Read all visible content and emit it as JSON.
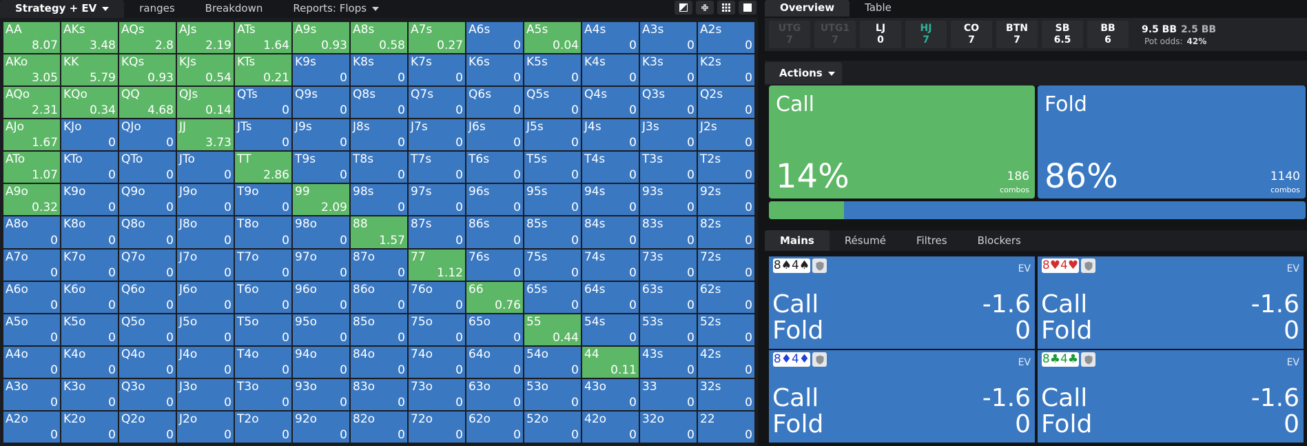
{
  "colors": {
    "green": "#5cb766",
    "blue": "#3a78c2",
    "teal": "#2fb39a"
  },
  "left_tabs": {
    "strategy": "Strategy + EV",
    "ranges": "ranges",
    "breakdown": "Breakdown",
    "reports": "Reports: Flops"
  },
  "toolbar_icons": [
    "contrast-icon",
    "collapse-icon",
    "grid-icon",
    "square-icon"
  ],
  "grid": {
    "rows": [
      [
        [
          "AA",
          "8.07",
          "g"
        ],
        [
          "AKs",
          "3.48",
          "g"
        ],
        [
          "AQs",
          "2.8",
          "g"
        ],
        [
          "AJs",
          "2.19",
          "g"
        ],
        [
          "ATs",
          "1.64",
          "g"
        ],
        [
          "A9s",
          "0.93",
          "g"
        ],
        [
          "A8s",
          "0.58",
          "g"
        ],
        [
          "A7s",
          "0.27",
          "g"
        ],
        [
          "A6s",
          "0",
          "b"
        ],
        [
          "A5s",
          "0.04",
          "g"
        ],
        [
          "A4s",
          "0",
          "b"
        ],
        [
          "A3s",
          "0",
          "b"
        ],
        [
          "A2s",
          "0",
          "b"
        ]
      ],
      [
        [
          "AKo",
          "3.05",
          "g"
        ],
        [
          "KK",
          "5.79",
          "g"
        ],
        [
          "KQs",
          "0.93",
          "g"
        ],
        [
          "KJs",
          "0.54",
          "g"
        ],
        [
          "KTs",
          "0.21",
          "g"
        ],
        [
          "K9s",
          "0",
          "b"
        ],
        [
          "K8s",
          "0",
          "b"
        ],
        [
          "K7s",
          "0",
          "b"
        ],
        [
          "K6s",
          "0",
          "b"
        ],
        [
          "K5s",
          "0",
          "b"
        ],
        [
          "K4s",
          "0",
          "b"
        ],
        [
          "K3s",
          "0",
          "b"
        ],
        [
          "K2s",
          "0",
          "b"
        ]
      ],
      [
        [
          "AQo",
          "2.31",
          "g"
        ],
        [
          "KQo",
          "0.34",
          "g"
        ],
        [
          "QQ",
          "4.68",
          "g"
        ],
        [
          "QJs",
          "0.14",
          "g"
        ],
        [
          "QTs",
          "0",
          "b"
        ],
        [
          "Q9s",
          "0",
          "b"
        ],
        [
          "Q8s",
          "0",
          "b"
        ],
        [
          "Q7s",
          "0",
          "b"
        ],
        [
          "Q6s",
          "0",
          "b"
        ],
        [
          "Q5s",
          "0",
          "b"
        ],
        [
          "Q4s",
          "0",
          "b"
        ],
        [
          "Q3s",
          "0",
          "b"
        ],
        [
          "Q2s",
          "0",
          "b"
        ]
      ],
      [
        [
          "AJo",
          "1.67",
          "g"
        ],
        [
          "KJo",
          "0",
          "b"
        ],
        [
          "QJo",
          "0",
          "b"
        ],
        [
          "JJ",
          "3.73",
          "g"
        ],
        [
          "JTs",
          "0",
          "b"
        ],
        [
          "J9s",
          "0",
          "b"
        ],
        [
          "J8s",
          "0",
          "b"
        ],
        [
          "J7s",
          "0",
          "b"
        ],
        [
          "J6s",
          "0",
          "b"
        ],
        [
          "J5s",
          "0",
          "b"
        ],
        [
          "J4s",
          "0",
          "b"
        ],
        [
          "J3s",
          "0",
          "b"
        ],
        [
          "J2s",
          "0",
          "b"
        ]
      ],
      [
        [
          "ATo",
          "1.07",
          "g"
        ],
        [
          "KTo",
          "0",
          "b"
        ],
        [
          "QTo",
          "0",
          "b"
        ],
        [
          "JTo",
          "0",
          "b"
        ],
        [
          "TT",
          "2.86",
          "g"
        ],
        [
          "T9s",
          "0",
          "b"
        ],
        [
          "T8s",
          "0",
          "b"
        ],
        [
          "T7s",
          "0",
          "b"
        ],
        [
          "T6s",
          "0",
          "b"
        ],
        [
          "T5s",
          "0",
          "b"
        ],
        [
          "T4s",
          "0",
          "b"
        ],
        [
          "T3s",
          "0",
          "b"
        ],
        [
          "T2s",
          "0",
          "b"
        ]
      ],
      [
        [
          "A9o",
          "0.32",
          "g"
        ],
        [
          "K9o",
          "0",
          "b"
        ],
        [
          "Q9o",
          "0",
          "b"
        ],
        [
          "J9o",
          "0",
          "b"
        ],
        [
          "T9o",
          "0",
          "b"
        ],
        [
          "99",
          "2.09",
          "g"
        ],
        [
          "98s",
          "0",
          "b"
        ],
        [
          "97s",
          "0",
          "b"
        ],
        [
          "96s",
          "0",
          "b"
        ],
        [
          "95s",
          "0",
          "b"
        ],
        [
          "94s",
          "0",
          "b"
        ],
        [
          "93s",
          "0",
          "b"
        ],
        [
          "92s",
          "0",
          "b"
        ]
      ],
      [
        [
          "A8o",
          "0",
          "b"
        ],
        [
          "K8o",
          "0",
          "b"
        ],
        [
          "Q8o",
          "0",
          "b"
        ],
        [
          "J8o",
          "0",
          "b"
        ],
        [
          "T8o",
          "0",
          "b"
        ],
        [
          "98o",
          "0",
          "b"
        ],
        [
          "88",
          "1.57",
          "g"
        ],
        [
          "87s",
          "0",
          "b"
        ],
        [
          "86s",
          "0",
          "b"
        ],
        [
          "85s",
          "0",
          "b"
        ],
        [
          "84s",
          "0",
          "b"
        ],
        [
          "83s",
          "0",
          "b"
        ],
        [
          "82s",
          "0",
          "b"
        ]
      ],
      [
        [
          "A7o",
          "0",
          "b"
        ],
        [
          "K7o",
          "0",
          "b"
        ],
        [
          "Q7o",
          "0",
          "b"
        ],
        [
          "J7o",
          "0",
          "b"
        ],
        [
          "T7o",
          "0",
          "b"
        ],
        [
          "97o",
          "0",
          "b"
        ],
        [
          "87o",
          "0",
          "b"
        ],
        [
          "77",
          "1.12",
          "g"
        ],
        [
          "76s",
          "0",
          "b"
        ],
        [
          "75s",
          "0",
          "b"
        ],
        [
          "74s",
          "0",
          "b"
        ],
        [
          "73s",
          "0",
          "b"
        ],
        [
          "72s",
          "0",
          "b"
        ]
      ],
      [
        [
          "A6o",
          "0",
          "b"
        ],
        [
          "K6o",
          "0",
          "b"
        ],
        [
          "Q6o",
          "0",
          "b"
        ],
        [
          "J6o",
          "0",
          "b"
        ],
        [
          "T6o",
          "0",
          "b"
        ],
        [
          "96o",
          "0",
          "b"
        ],
        [
          "86o",
          "0",
          "b"
        ],
        [
          "76o",
          "0",
          "b"
        ],
        [
          "66",
          "0.76",
          "g"
        ],
        [
          "65s",
          "0",
          "b"
        ],
        [
          "64s",
          "0",
          "b"
        ],
        [
          "63s",
          "0",
          "b"
        ],
        [
          "62s",
          "0",
          "b"
        ]
      ],
      [
        [
          "A5o",
          "0",
          "b"
        ],
        [
          "K5o",
          "0",
          "b"
        ],
        [
          "Q5o",
          "0",
          "b"
        ],
        [
          "J5o",
          "0",
          "b"
        ],
        [
          "T5o",
          "0",
          "b"
        ],
        [
          "95o",
          "0",
          "b"
        ],
        [
          "85o",
          "0",
          "b"
        ],
        [
          "75o",
          "0",
          "b"
        ],
        [
          "65o",
          "0",
          "b"
        ],
        [
          "55",
          "0.44",
          "g"
        ],
        [
          "54s",
          "0",
          "b"
        ],
        [
          "53s",
          "0",
          "b"
        ],
        [
          "52s",
          "0",
          "b"
        ]
      ],
      [
        [
          "A4o",
          "0",
          "b"
        ],
        [
          "K4o",
          "0",
          "b"
        ],
        [
          "Q4o",
          "0",
          "b"
        ],
        [
          "J4o",
          "0",
          "b"
        ],
        [
          "T4o",
          "0",
          "b"
        ],
        [
          "94o",
          "0",
          "b"
        ],
        [
          "84o",
          "0",
          "b"
        ],
        [
          "74o",
          "0",
          "b"
        ],
        [
          "64o",
          "0",
          "b"
        ],
        [
          "54o",
          "0",
          "b"
        ],
        [
          "44",
          "0.11",
          "g"
        ],
        [
          "43s",
          "0",
          "b"
        ],
        [
          "42s",
          "0",
          "b"
        ]
      ],
      [
        [
          "A3o",
          "0",
          "b"
        ],
        [
          "K3o",
          "0",
          "b"
        ],
        [
          "Q3o",
          "0",
          "b"
        ],
        [
          "J3o",
          "0",
          "b"
        ],
        [
          "T3o",
          "0",
          "b"
        ],
        [
          "93o",
          "0",
          "b"
        ],
        [
          "83o",
          "0",
          "b"
        ],
        [
          "73o",
          "0",
          "b"
        ],
        [
          "63o",
          "0",
          "b"
        ],
        [
          "53o",
          "0",
          "b"
        ],
        [
          "43o",
          "0",
          "b"
        ],
        [
          "33",
          "0",
          "b"
        ],
        [
          "32s",
          "0",
          "b"
        ]
      ],
      [
        [
          "A2o",
          "0",
          "b"
        ],
        [
          "K2o",
          "0",
          "b"
        ],
        [
          "Q2o",
          "0",
          "b"
        ],
        [
          "J2o",
          "0",
          "b"
        ],
        [
          "T2o",
          "0",
          "b"
        ],
        [
          "92o",
          "0",
          "b"
        ],
        [
          "82o",
          "0",
          "b"
        ],
        [
          "72o",
          "0",
          "b"
        ],
        [
          "62o",
          "0",
          "b"
        ],
        [
          "52o",
          "0",
          "b"
        ],
        [
          "42o",
          "0",
          "b"
        ],
        [
          "32o",
          "0",
          "b"
        ],
        [
          "22",
          "0",
          "b"
        ]
      ]
    ]
  },
  "right_tabs": {
    "overview": "Overview",
    "table": "Table"
  },
  "positions": [
    {
      "name": "UTG",
      "stack": "7",
      "state": "dim"
    },
    {
      "name": "UTG1",
      "stack": "7",
      "state": "dim"
    },
    {
      "name": "LJ",
      "stack": "0",
      "state": "normal"
    },
    {
      "name": "HJ",
      "stack": "7",
      "state": "current"
    },
    {
      "name": "CO",
      "stack": "7",
      "state": "normal"
    },
    {
      "name": "BTN",
      "stack": "7",
      "state": "normal"
    },
    {
      "name": "SB",
      "stack": "6.5",
      "state": "normal"
    },
    {
      "name": "BB",
      "stack": "6",
      "state": "normal"
    }
  ],
  "pot": {
    "bb1": "9.5 BB",
    "bb2": "2.5 BB",
    "odds_label": "Pot odds:",
    "odds_value": "42%"
  },
  "actions_dropdown": "Actions",
  "actions": [
    {
      "name": "Call",
      "percent": "14%",
      "combos": "186",
      "combos_label": "combos",
      "color": "#5cb766",
      "frequency": 0.14
    },
    {
      "name": "Fold",
      "percent": "86%",
      "combos": "1140",
      "combos_label": "combos",
      "color": "#3a78c2",
      "frequency": 0.86
    }
  ],
  "sub_tabs": [
    "Mains",
    "Résumé",
    "Filtres",
    "Blockers"
  ],
  "combos": [
    {
      "c1": "8",
      "s1": "♠",
      "c2": "4",
      "s2": "♠",
      "suit_color": "#222222",
      "ev_label": "EV",
      "call_label": "Call",
      "call_value": "-1.6",
      "fold_label": "Fold",
      "fold_value": "0"
    },
    {
      "c1": "8",
      "s1": "♥",
      "c2": "4",
      "s2": "♥",
      "suit_color": "#d32f2f",
      "ev_label": "EV",
      "call_label": "Call",
      "call_value": "-1.6",
      "fold_label": "Fold",
      "fold_value": "0"
    },
    {
      "c1": "8",
      "s1": "♦",
      "c2": "4",
      "s2": "♦",
      "suit_color": "#1e3fd8",
      "ev_label": "EV",
      "call_label": "Call",
      "call_value": "-1.6",
      "fold_label": "Fold",
      "fold_value": "0"
    },
    {
      "c1": "8",
      "s1": "♣",
      "c2": "4",
      "s2": "♣",
      "suit_color": "#1a9a3a",
      "ev_label": "EV",
      "call_label": "Call",
      "call_value": "-1.6",
      "fold_label": "Fold",
      "fold_value": "0"
    }
  ]
}
